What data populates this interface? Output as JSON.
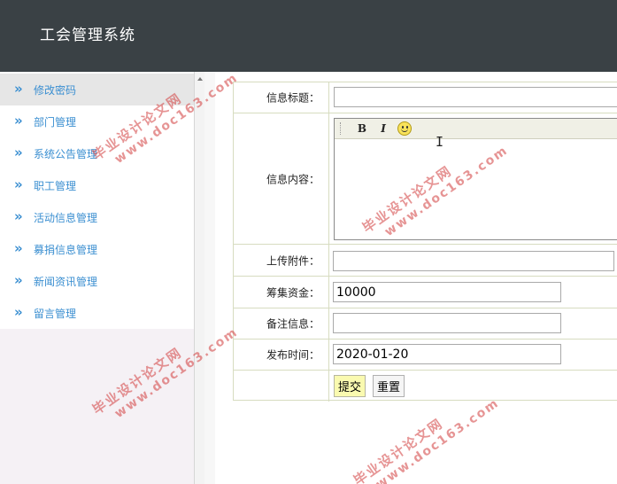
{
  "app": {
    "title": "工会管理系统"
  },
  "sidebar": {
    "items": [
      {
        "label": "修改密码"
      },
      {
        "label": "部门管理"
      },
      {
        "label": "系统公告管理"
      },
      {
        "label": "职工管理"
      },
      {
        "label": "活动信息管理"
      },
      {
        "label": "募捐信息管理"
      },
      {
        "label": "新闻资讯管理"
      },
      {
        "label": "留言管理"
      }
    ],
    "chevron": "»",
    "active_index": 0
  },
  "form": {
    "title_label": "信息标题：",
    "title_value": "",
    "content_label": "信息内容：",
    "upload_label": "上传附件：",
    "upload_value": "",
    "funds_label": "筹集资金：",
    "funds_value": "10000",
    "remark_label": "备注信息：",
    "remark_value": "",
    "publish_label": "发布时间：",
    "publish_value": "2020-01-20",
    "submit_label": "提交",
    "reset_label": "重置"
  },
  "editor": {
    "bold_label": "B",
    "italic_label": "I",
    "emoticon_icon": "smiley-icon"
  },
  "watermark": {
    "text": "毕业设计论文网",
    "url": "www.doc163.com"
  },
  "colors": {
    "header_bg": "#3a4145",
    "sidebar_link": "#3b8fd1",
    "table_border": "#d7dcc0",
    "submit_bg": "#fafab0",
    "watermark": "#d23c3c"
  }
}
